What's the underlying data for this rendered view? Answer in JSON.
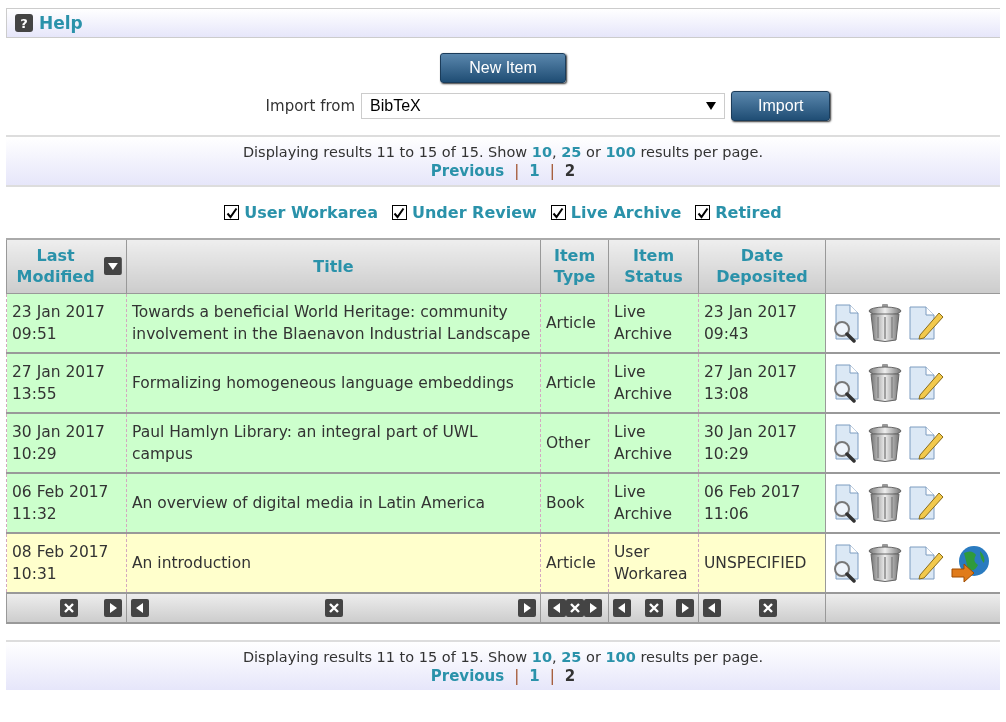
{
  "help": {
    "icon": "?",
    "label": "Help"
  },
  "new_item_button": "New Item",
  "import": {
    "label": "Import from",
    "value": "BibTeX",
    "button": "Import"
  },
  "pager_top": {
    "segments": [
      {
        "kind": "text",
        "text": "Displaying results 11 to 15 of 15. Show "
      },
      {
        "kind": "link",
        "text": "10"
      },
      {
        "kind": "text",
        "text": ", "
      },
      {
        "kind": "link",
        "text": "25"
      },
      {
        "kind": "text",
        "text": " or "
      },
      {
        "kind": "link",
        "text": "100"
      },
      {
        "kind": "text",
        "text": " results per page."
      }
    ],
    "separator": "|",
    "pages": [
      {
        "label": "Previous",
        "selected": false
      },
      {
        "label": "1",
        "selected": false
      },
      {
        "label": "2",
        "selected": true
      }
    ]
  },
  "filters": [
    {
      "label": "User Workarea",
      "checked": true
    },
    {
      "label": "Under Review",
      "checked": true
    },
    {
      "label": "Live Archive",
      "checked": true
    },
    {
      "label": "Retired",
      "checked": true
    }
  ],
  "table": {
    "columns": [
      {
        "label": "Last Modified",
        "sorted": true
      },
      {
        "label": "Title",
        "sorted": false
      },
      {
        "label": "Item Type",
        "sorted": false
      },
      {
        "label": "Item Status",
        "sorted": false
      },
      {
        "label": "Date Deposited",
        "sorted": false
      }
    ],
    "rows": [
      {
        "kind": "live",
        "modified": "23 Jan 2017 09:51",
        "title": "Towards a beneficial World Heritage: community involvement in the Blaenavon Industrial Landscape",
        "type": "Article",
        "status": "Live Archive",
        "deposited": "23 Jan 2017 09:43",
        "exportable": false
      },
      {
        "kind": "live",
        "modified": "27 Jan 2017 13:55",
        "title": "Formalizing homogeneous language embeddings",
        "type": "Article",
        "status": "Live Archive",
        "deposited": "27 Jan 2017 13:08",
        "exportable": false
      },
      {
        "kind": "live",
        "modified": "30 Jan 2017 10:29",
        "title": "Paul Hamlyn Library: an integral part of UWL campus",
        "type": "Other",
        "status": "Live Archive",
        "deposited": "30 Jan 2017 10:29",
        "exportable": false
      },
      {
        "kind": "live",
        "modified": "06 Feb 2017 11:32",
        "title": "An overview of digital media in Latin America",
        "type": "Book",
        "status": "Live Archive",
        "deposited": "06 Feb 2017 11:06",
        "exportable": false
      },
      {
        "kind": "workarea",
        "modified": "08 Feb 2017 10:31",
        "title": "An introduction",
        "type": "Article",
        "status": "User Workarea",
        "deposited": "UNSPECIFIED",
        "exportable": true
      }
    ]
  },
  "pager_bottom": {
    "segments": [
      {
        "kind": "text",
        "text": "Displaying results 11 to 15 of 15. Show "
      },
      {
        "kind": "link",
        "text": "10"
      },
      {
        "kind": "text",
        "text": ", "
      },
      {
        "kind": "link",
        "text": "25"
      },
      {
        "kind": "text",
        "text": " or "
      },
      {
        "kind": "link",
        "text": "100"
      },
      {
        "kind": "text",
        "text": " results per page."
      }
    ],
    "separator": "|",
    "pages": [
      {
        "label": "Previous",
        "selected": false
      },
      {
        "label": "1",
        "selected": false
      },
      {
        "label": "2",
        "selected": true
      }
    ]
  }
}
